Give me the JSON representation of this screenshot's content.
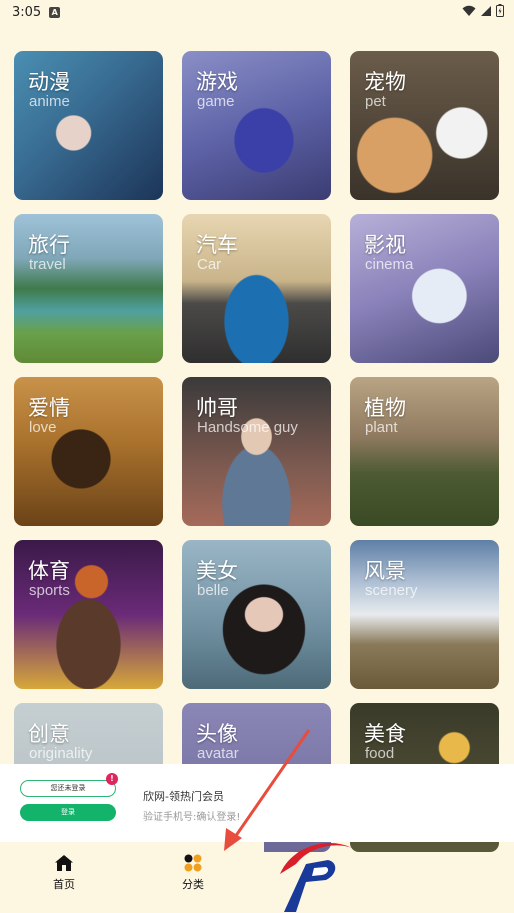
{
  "status": {
    "time": "3:05",
    "notif_letter": "A"
  },
  "categories": [
    {
      "title": "动漫",
      "sub": "anime"
    },
    {
      "title": "游戏",
      "sub": "game"
    },
    {
      "title": "宠物",
      "sub": "pet"
    },
    {
      "title": "旅行",
      "sub": "travel"
    },
    {
      "title": "汽车",
      "sub": "Car"
    },
    {
      "title": "影视",
      "sub": "cinema"
    },
    {
      "title": "爱情",
      "sub": "love"
    },
    {
      "title": "帅哥",
      "sub": "Handsome guy"
    },
    {
      "title": "植物",
      "sub": "plant"
    },
    {
      "title": "体育",
      "sub": "sports"
    },
    {
      "title": "美女",
      "sub": "belle"
    },
    {
      "title": "风景",
      "sub": "scenery"
    },
    {
      "title": "创意",
      "sub": "originality"
    },
    {
      "title": "头像",
      "sub": "avatar"
    },
    {
      "title": "美食",
      "sub": "food"
    }
  ],
  "banner": {
    "field_text": "您还未登录",
    "badge": "!",
    "button_text": "登录",
    "title": "欣网-领热门会员",
    "subtitle": "验证手机号:确认登录!"
  },
  "tabbar": {
    "home": "首页",
    "category": "分类"
  },
  "colors": {
    "background": "#fdf7e2",
    "accent_green": "#13b36b",
    "arrow_red": "#e74c3c"
  }
}
